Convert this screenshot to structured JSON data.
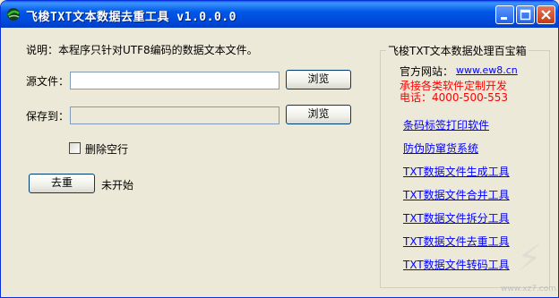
{
  "window": {
    "title": "飞梭TXT文本数据去重工具 v1.0.0.0"
  },
  "main": {
    "description": "说明：本程序只针对UTF8编码的数据文本文件。",
    "source_label": "源文件：",
    "source_value": "",
    "browse_label": "浏览",
    "save_label": "保存到：",
    "save_value": "",
    "browse2_label": "浏览",
    "delete_blank_label": "删除空行",
    "dedupe_button": "去重",
    "status": "未开始"
  },
  "panel": {
    "title": "飞梭TXT文本数据处理百宝箱",
    "site_label": "官方网站：",
    "site_url": "www.ew8.cn",
    "custom_dev": "承接各类软件定制开发",
    "phone": "电话：4000-500-553",
    "links": [
      "条码标签打印软件",
      "防伪防窜货系统",
      "TXT数据文件生成工具",
      "TXT数据文件合并工具",
      "TXT数据文件拆分工具",
      "TXT数据文件去重工具",
      "TXT数据文件转码工具"
    ]
  },
  "watermark": {
    "text": "www.xz7.com"
  },
  "colors": {
    "titlebar": "#0054e3",
    "link": "#0000ff",
    "highlight": "#ff0000",
    "background": "#ece9d8"
  }
}
